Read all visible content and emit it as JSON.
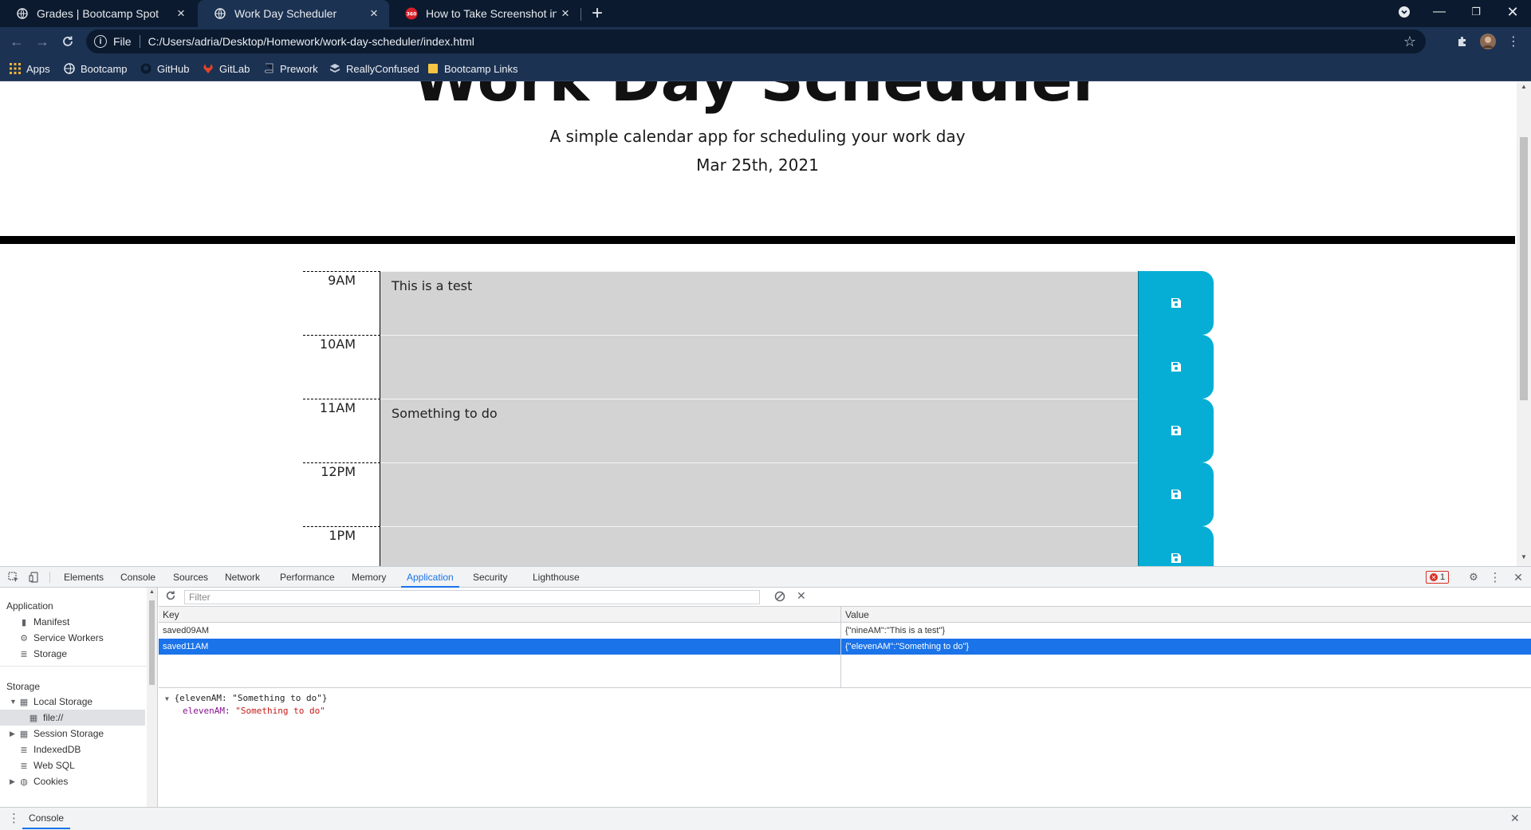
{
  "browser": {
    "tabs": [
      {
        "title": "Grades | Bootcamp Spot",
        "active": false
      },
      {
        "title": "Work Day Scheduler",
        "active": true
      },
      {
        "title": "How to Take Screenshot in Windows",
        "active": false
      }
    ],
    "address": {
      "scheme": "File",
      "url": "C:/Users/adria/Desktop/Homework/work-day-scheduler/index.html"
    },
    "bookmarks": [
      {
        "label": "Apps",
        "icon": "apps-grid-icon"
      },
      {
        "label": "Bootcamp",
        "icon": "globe-icon"
      },
      {
        "label": "GitHub",
        "icon": "github-icon"
      },
      {
        "label": "GitLab",
        "icon": "gitlab-icon"
      },
      {
        "label": "Prework",
        "icon": "book-icon"
      },
      {
        "label": "ReallyConfused",
        "icon": "stack-icon"
      },
      {
        "label": "Bootcamp Links",
        "icon": "folder-icon"
      }
    ]
  },
  "page": {
    "title": "Work Day Scheduler",
    "lead": "A simple calendar app for scheduling your work day",
    "date": "Mar 25th, 2021",
    "rows": [
      {
        "hour": "9AM",
        "text": "This is a test"
      },
      {
        "hour": "10AM",
        "text": ""
      },
      {
        "hour": "11AM",
        "text": "Something to do"
      },
      {
        "hour": "12PM",
        "text": ""
      },
      {
        "hour": "1PM",
        "text": ""
      }
    ],
    "colors": {
      "save": "#06aed5",
      "past": "#d3d3d3"
    }
  },
  "devtools": {
    "tabs": [
      "Elements",
      "Console",
      "Sources",
      "Network",
      "Performance",
      "Memory",
      "Application",
      "Security",
      "Lighthouse"
    ],
    "active_tab": "Application",
    "error_count": "1",
    "sidebar": {
      "application_heading": "Application",
      "application_items": [
        "Manifest",
        "Service Workers",
        "Storage"
      ],
      "storage_heading": "Storage",
      "local_storage": "Local Storage",
      "local_storage_child": "file://",
      "session_storage": "Session Storage",
      "indexeddb": "IndexedDB",
      "websql": "Web SQL",
      "cookies": "Cookies"
    },
    "filter_placeholder": "Filter",
    "table": {
      "key_header": "Key",
      "value_header": "Value",
      "rows": [
        {
          "key": "saved09AM",
          "value": "{\"nineAM\":\"This is a test\"}",
          "selected": false
        },
        {
          "key": "saved11AM",
          "value": "{\"elevenAM\":\"Something to do\"}",
          "selected": true
        }
      ]
    },
    "preview": {
      "object": "{elevenAM: \"Something to do\"}",
      "prop_key": "elevenAM",
      "prop_value": "\"Something to do\""
    },
    "drawer_tab": "Console"
  }
}
